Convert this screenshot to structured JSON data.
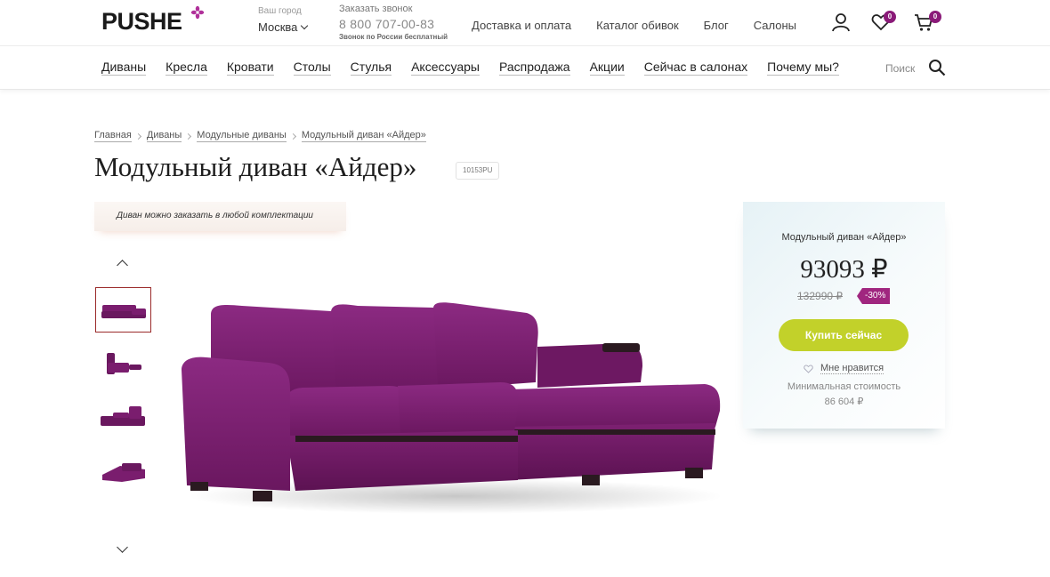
{
  "header": {
    "logo": "PUSHE",
    "city_label": "Ваш город",
    "city_value": "Москва",
    "call_label": "Заказать звонок",
    "phone": "8 800 707-00-83",
    "phone_note": "Звонок по России бесплатный",
    "links": [
      "Доставка и оплата",
      "Каталог обивок",
      "Блог",
      "Салоны"
    ],
    "wishlist_count": "0",
    "cart_count": "0"
  },
  "nav": {
    "items": [
      "Диваны",
      "Кресла",
      "Кровати",
      "Столы",
      "Стулья",
      "Аксессуары",
      "Распродажа",
      "Акции",
      "Сейчас в салонах",
      "Почему мы?"
    ],
    "search_label": "Поиск"
  },
  "breadcrumb": [
    "Главная",
    "Диваны",
    "Модульные диваны",
    "Модульный диван «Айдер»"
  ],
  "product": {
    "title": "Модульный диван «Айдер»",
    "sku": "10153PU",
    "notice": "Диван можно заказать в любой комплектации"
  },
  "price_card": {
    "title": "Модульный диван «Айдер»",
    "price": "93093 ₽",
    "old_price": "132990 ₽",
    "discount": "-30%",
    "buy_label": "Купить сейчас",
    "like_label": "Мне нравится",
    "min_cost_label": "Минимальная стоимость",
    "min_cost_value": "86 604 ₽"
  },
  "colors": {
    "accent_purple": "#8a1a78",
    "discount_badge": "#a0267f",
    "buy_button": "#c2d12a",
    "sofa": "#7a1d6e"
  }
}
